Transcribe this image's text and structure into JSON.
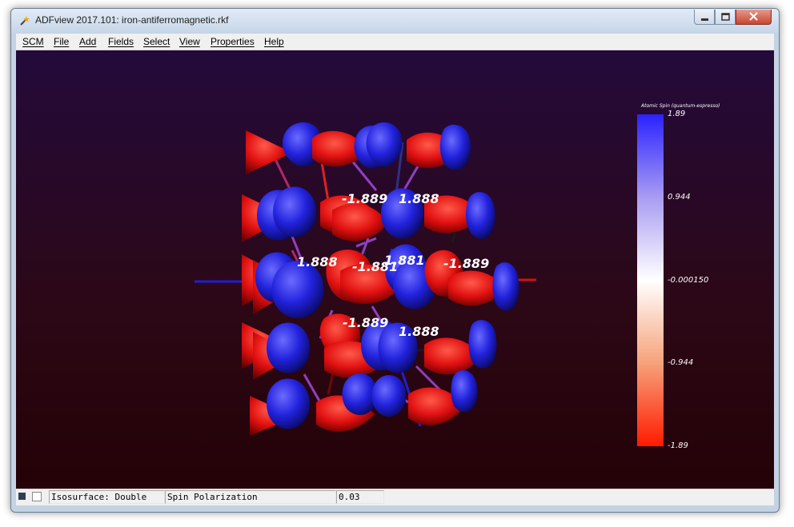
{
  "window": {
    "title": "ADFview 2017.101: iron-antiferromagnetic.rkf",
    "icon": "adf-wand-icon"
  },
  "menu": [
    "SCM",
    "File",
    "Add",
    "Fields",
    "Select",
    "View",
    "Properties",
    "Help"
  ],
  "colors": {
    "spin_up_atom": "#2a2ae6",
    "spin_down_atom": "#e61010",
    "scale_top": "#2a22ff",
    "scale_mid": "#ffffff",
    "scale_bottom": "#ff1a00",
    "viewport_top": "#230a3a",
    "viewport_bottom": "#240207"
  },
  "viewport": {
    "atom_values": [
      "-1.889",
      "1.888",
      "1.888",
      "-1.881",
      "1.881",
      "-1.889",
      "-1.889",
      "1.888"
    ]
  },
  "color_scale": {
    "title": "Atomic Spin (quantum-espresso)",
    "labels": [
      "1.89",
      "0.944",
      "-0.000150",
      "-0.944",
      "-1.89"
    ]
  },
  "statusbar": {
    "field1": "Isosurface: Double",
    "field2": "Spin Polarization",
    "field3": "0.03"
  }
}
